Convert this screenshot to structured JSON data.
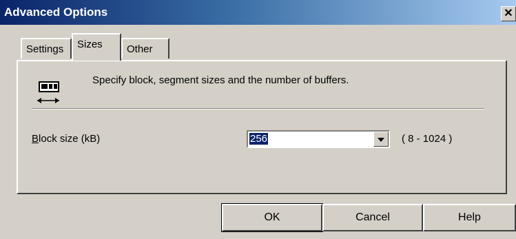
{
  "window": {
    "title": "Advanced Options",
    "close_glyph": "✕"
  },
  "tabs": [
    {
      "label": "Settings",
      "active": false
    },
    {
      "label": "Sizes",
      "active": true
    },
    {
      "label": "Other",
      "active": false
    }
  ],
  "sizes_panel": {
    "icon": "tape-drive-icon",
    "description": "Specify block, segment sizes and the number of buffers.",
    "block_size": {
      "label_accesskey": "B",
      "label_rest": "lock size (kB)",
      "value": "256",
      "range": "( 8 - 1024 )"
    }
  },
  "buttons": {
    "ok": "OK",
    "cancel": "Cancel",
    "help": "Help"
  },
  "colors": {
    "title_start": "#0a246a",
    "title_end": "#a6caf0",
    "face": "#d4d0c8",
    "selection": "#0a246a"
  }
}
